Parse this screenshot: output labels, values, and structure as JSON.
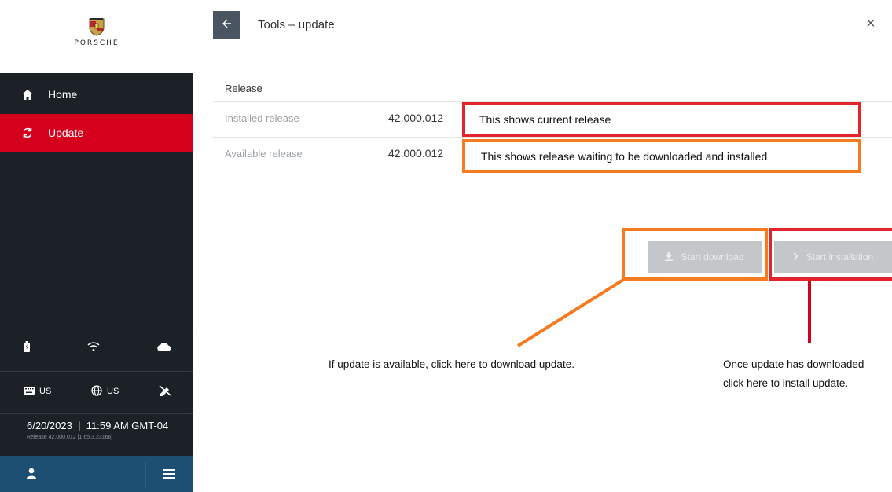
{
  "brand": {
    "name": "PORSCHE"
  },
  "sidebar": {
    "items": [
      {
        "label": "Home",
        "icon": "home-icon",
        "active": false
      },
      {
        "label": "Update",
        "icon": "refresh-icon",
        "active": true
      }
    ],
    "status_icons": [
      "battery-icon",
      "wifi-icon",
      "cloud-icon"
    ],
    "locale": {
      "keyboard": "US",
      "language": "US",
      "extra_icon": "no-edit-icon"
    },
    "date": "6/20/2023",
    "time": "11:59 AM GMT-04",
    "date_separator": "|",
    "release_info": "Release 42.000.012 [1.65.3.23166]"
  },
  "header": {
    "title": "Tools – update",
    "close": "×"
  },
  "release": {
    "heading": "Release",
    "rows": [
      {
        "label": "Installed release",
        "value": "42.000.012"
      },
      {
        "label": "Available release",
        "value": "42.000.012"
      }
    ]
  },
  "annotations": {
    "current": "This shows current release",
    "waiting": "This shows release waiting to be downloaded and installed",
    "download_note": "If update is available, click here to download update.",
    "install_note_line1": "Once update has downloaded",
    "install_note_line2": "click here to install update."
  },
  "actions": {
    "download_label": "Start download",
    "install_label": "Start installation",
    "disabled": true
  },
  "colors": {
    "accent_red": "#d5001c",
    "annotation_red": "#e3242b",
    "annotation_orange": "#f47b20",
    "sidebar_bg": "#1c2127",
    "user_bar": "#1c4f72"
  }
}
